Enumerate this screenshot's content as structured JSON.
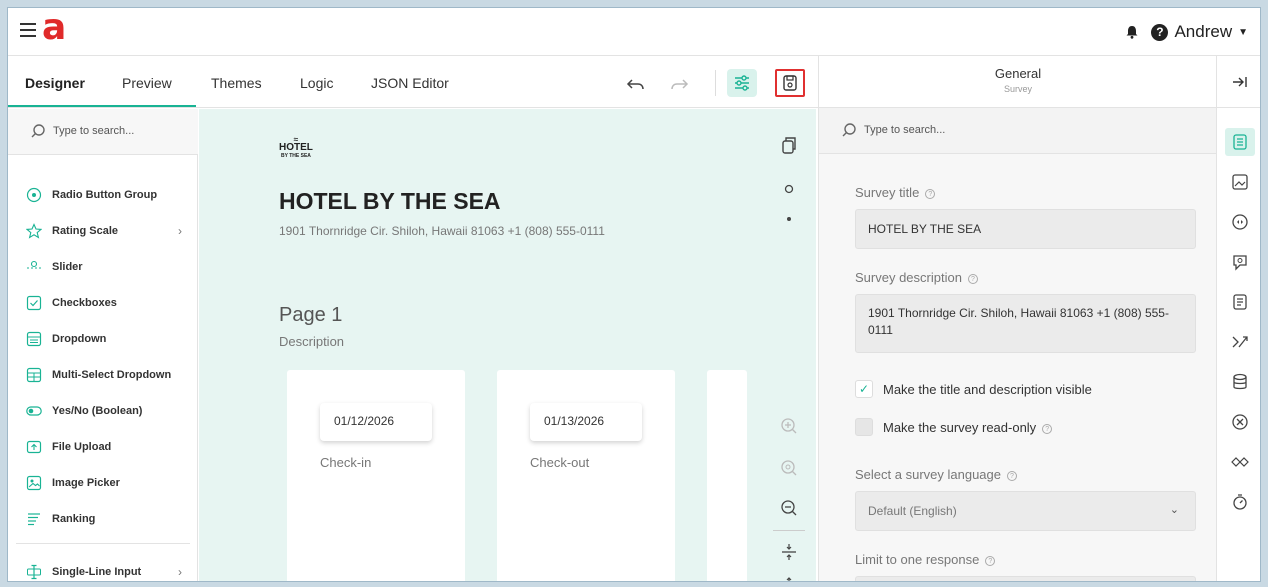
{
  "header": {
    "menu_icon": "hamburger-icon",
    "logo_text": "a",
    "user_name": "Andrew"
  },
  "tabs": [
    {
      "label": "Designer",
      "active": true
    },
    {
      "label": "Preview"
    },
    {
      "label": "Themes"
    },
    {
      "label": "Logic"
    },
    {
      "label": "JSON Editor"
    }
  ],
  "toolbox": {
    "search_placeholder": "Type to search...",
    "items": [
      {
        "label": "Radio Button Group",
        "icon": "radio-icon"
      },
      {
        "label": "Rating Scale",
        "icon": "star-icon",
        "has_submenu": true
      },
      {
        "label": "Slider",
        "icon": "slider-icon"
      },
      {
        "label": "Checkboxes",
        "icon": "checkbox-icon"
      },
      {
        "label": "Dropdown",
        "icon": "dropdown-icon"
      },
      {
        "label": "Multi-Select Dropdown",
        "icon": "multiselect-icon"
      },
      {
        "label": "Yes/No (Boolean)",
        "icon": "toggle-icon"
      },
      {
        "label": "File Upload",
        "icon": "upload-icon"
      },
      {
        "label": "Image Picker",
        "icon": "image-picker-icon"
      },
      {
        "label": "Ranking",
        "icon": "ranking-icon"
      },
      {
        "label": "Single-Line Input",
        "icon": "text-input-icon",
        "has_submenu": true
      }
    ]
  },
  "survey": {
    "logo_line1": "HOTEL",
    "logo_line2": "BY THE SEA",
    "title": "HOTEL BY THE SEA",
    "description": "1901 Thornridge Cir. Shiloh, Hawaii 81063 +1 (808) 555-0111",
    "page_title": "Page 1",
    "page_description": "Description",
    "questions": [
      {
        "value": "01/12/2026",
        "label": "Check-in"
      },
      {
        "value": "01/13/2026",
        "label": "Check-out"
      }
    ]
  },
  "properties": {
    "header_title": "General",
    "header_subtitle": "Survey",
    "search_placeholder": "Type to search...",
    "survey_title_label": "Survey title",
    "survey_title_value": "HOTEL BY THE SEA",
    "survey_desc_label": "Survey description",
    "survey_desc_value": "1901 Thornridge Cir. Shiloh, Hawaii 81063 +1 (808) 555-0111",
    "visible_label": "Make the title and description visible",
    "visible_checked": true,
    "readonly_label": "Make the survey read-only",
    "readonly_checked": false,
    "language_label": "Select a survey language",
    "language_value": "Default (English)",
    "limit_label": "Limit to one response"
  },
  "colors": {
    "accent": "#19b394",
    "brand_red": "#e02a2a",
    "highlight_border": "#e03030"
  }
}
